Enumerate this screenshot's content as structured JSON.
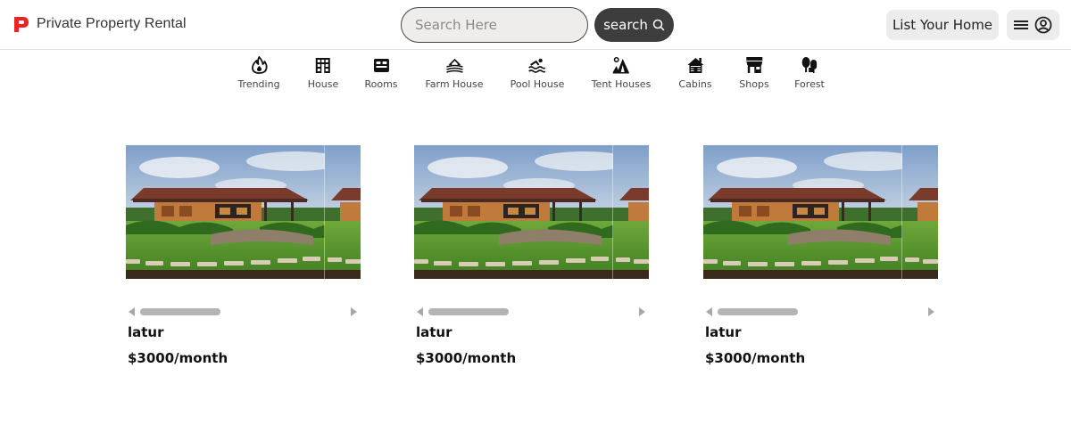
{
  "colors": {
    "brand": "#e8261f",
    "search_button_bg": "#3d3d3d",
    "search_input_bg": "#efedeb",
    "secondary_button_bg": "#ececec",
    "divider": "#e2e2e2"
  },
  "header": {
    "brand_name": "Private Property Rental",
    "brand_icon": "p-logo-icon",
    "search": {
      "placeholder": "Search Here",
      "value": ""
    },
    "search_button_label": "search",
    "search_button_icon": "search-icon",
    "list_home_label": "List Your Home",
    "menu_icons": [
      "hamburger-menu-icon",
      "user-account-icon"
    ]
  },
  "categories": [
    {
      "label": "Trending",
      "icon": "flame-icon"
    },
    {
      "label": "House",
      "icon": "house-building-icon"
    },
    {
      "label": "Rooms",
      "icon": "bed-icon"
    },
    {
      "label": "Farm House",
      "icon": "farm-field-icon"
    },
    {
      "label": "Pool House",
      "icon": "swimming-icon"
    },
    {
      "label": "Tent Houses",
      "icon": "tent-icon"
    },
    {
      "label": "Cabins",
      "icon": "cabin-icon"
    },
    {
      "label": "Shops",
      "icon": "store-icon"
    },
    {
      "label": "Forest",
      "icon": "trees-icon"
    }
  ],
  "listings": [
    {
      "location": "latur",
      "price": "$3000/month",
      "image": "house-garden-photo"
    },
    {
      "location": "latur",
      "price": "$3000/month",
      "image": "house-garden-photo"
    },
    {
      "location": "latur",
      "price": "$3000/month",
      "image": "house-garden-photo"
    }
  ]
}
